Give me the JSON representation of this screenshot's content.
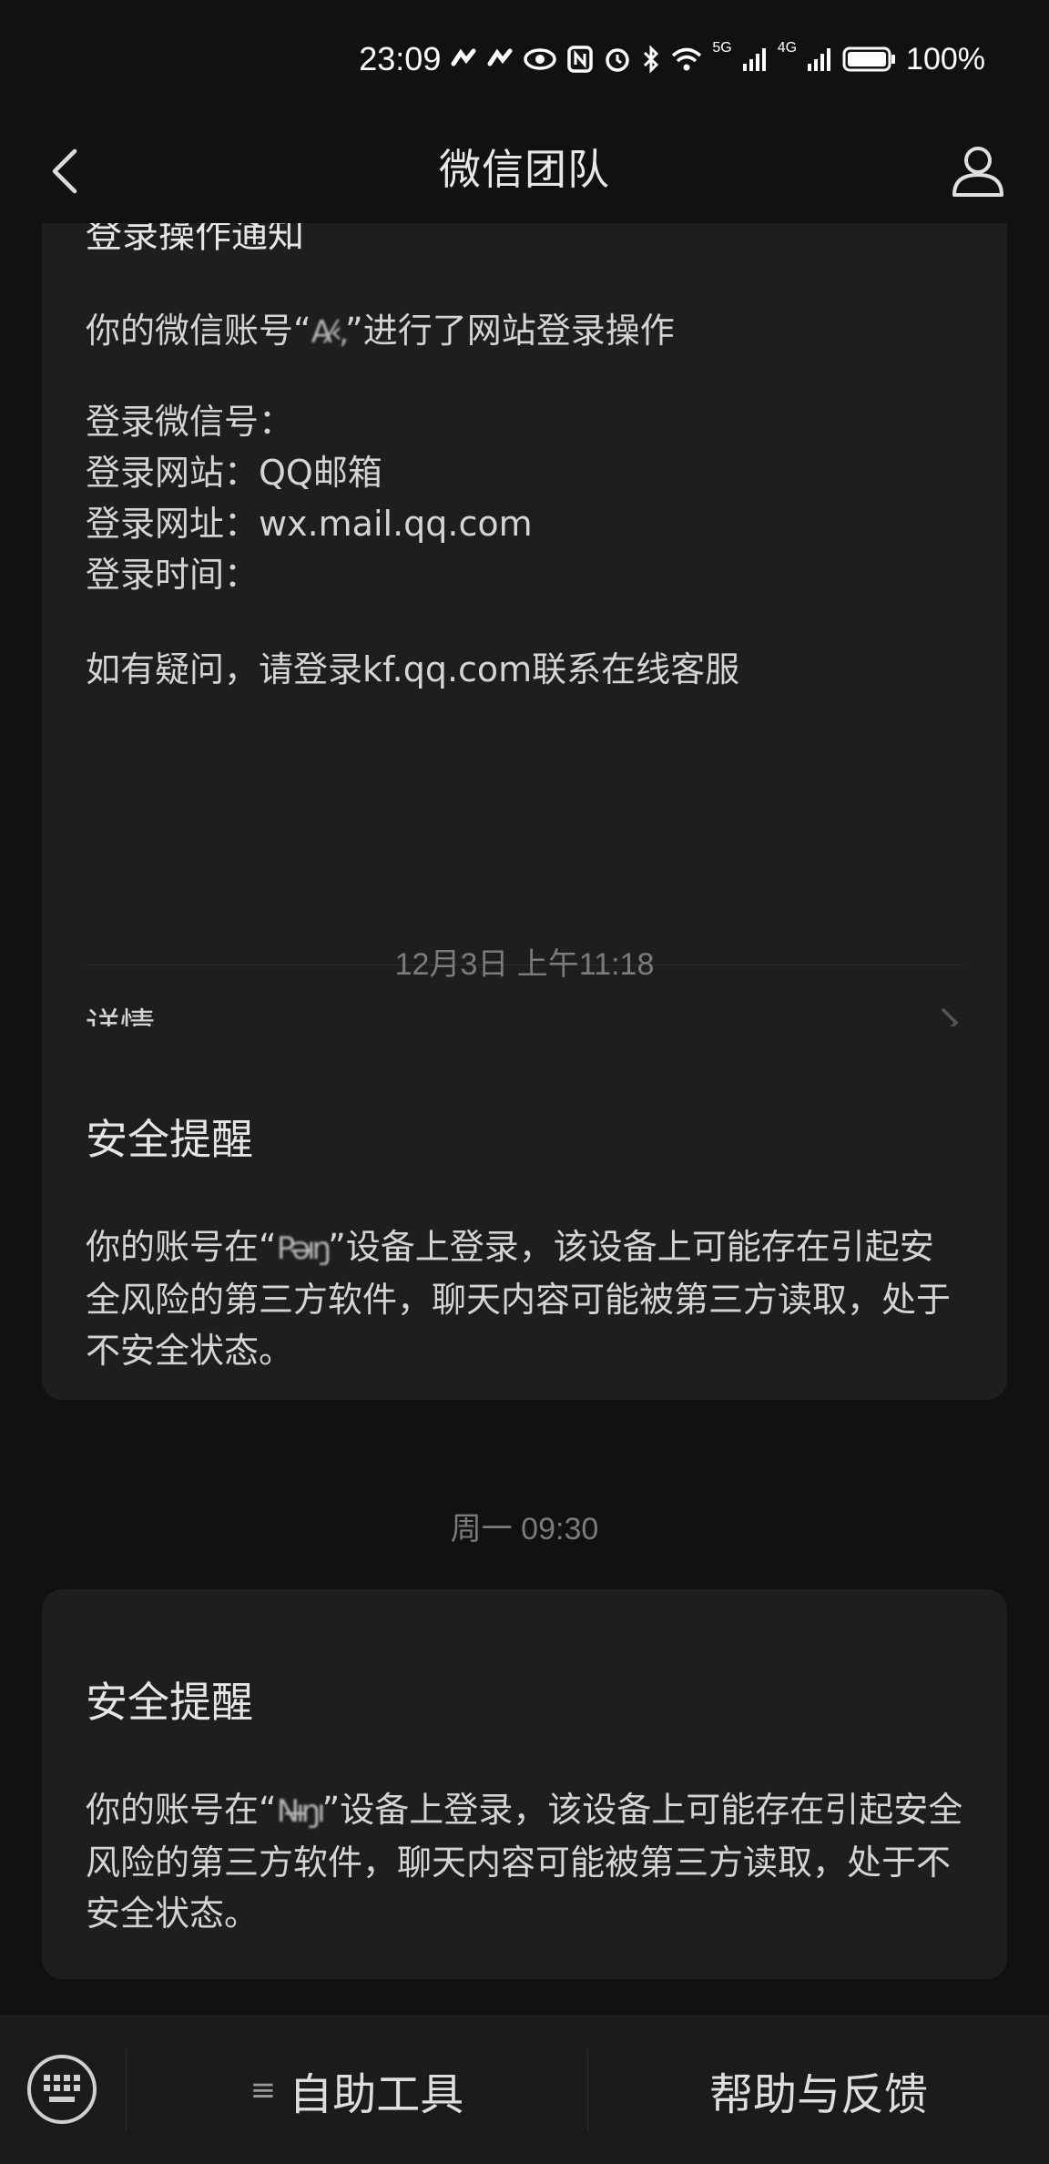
{
  "status": {
    "time": "23:09",
    "battery": "100%",
    "net1": "5G",
    "net2": "4G"
  },
  "nav": {
    "title": "微信团队",
    "back_icon": "chevron-left-icon",
    "profile_icon": "person-icon"
  },
  "messages": [
    {
      "title": "登录操作通知",
      "line1_prefix": "你的微信账号“",
      "line1_masked": "A⁄‹,",
      "line1_suffix": "”进行了网站登录操作",
      "fields": [
        "登录微信号：",
        "登录网站：QQ邮箱",
        "登录网址：wx.mail.qq.com",
        "登录时间："
      ],
      "footer": "如有疑问，请登录kf.qq.com联系在线客服",
      "detail_label": "详情"
    },
    {
      "timestamp": "12月3日 上午11:18",
      "title": "安全提醒",
      "prefix": "你的账号在“",
      "masked": "Pǝ̶ıŋ",
      "body": "”设备上登录，该设备上可能存在引起安全风险的第三方软件，聊天内容可能被第三方读取，处于不安全状态。"
    },
    {
      "timestamp": "周一 09:30",
      "title": "安全提醒",
      "prefix": "你的账号在“",
      "masked": "Nı̶ŋı",
      "body": "”设备上登录，该设备上可能存在引起安全风险的第三方软件，聊天内容可能被第三方读取，处于不安全状态。"
    }
  ],
  "bottom": {
    "keyboard_icon": "keyboard-icon",
    "menu_glyph": "≡",
    "tool_label": "自助工具",
    "help_label": "帮助与反馈"
  }
}
